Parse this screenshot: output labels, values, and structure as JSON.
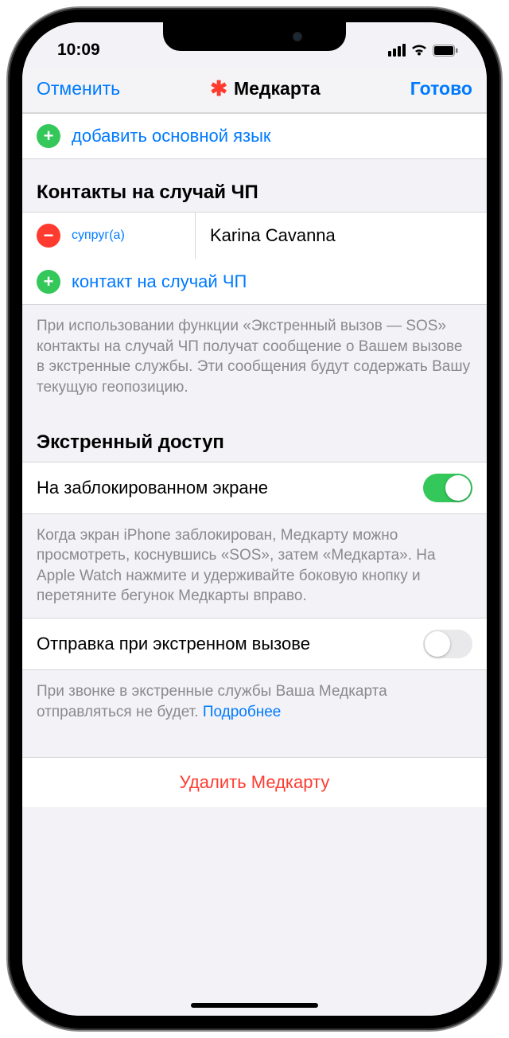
{
  "status": {
    "time": "10:09"
  },
  "nav": {
    "cancel": "Отменить",
    "title": "Медкарта",
    "done": "Готово"
  },
  "language": {
    "add_label": "добавить основной язык"
  },
  "emergency_contacts": {
    "header": "Контакты на случай ЧП",
    "contact": {
      "relation": "супруг(а)",
      "name": "Karina Cavanna"
    },
    "add_label": "контакт на случай ЧП",
    "footer": "При использовании функции «Экстренный вызов — SOS» контакты на случай ЧП получат сообщение о Вашем вызове в экстренные службы. Эти сообщения будут содержать Вашу текущую геопозицию."
  },
  "emergency_access": {
    "header": "Экстренный доступ",
    "lockscreen_label": "На заблокированном экране",
    "lockscreen_footer": "Когда экран iPhone заблокирован, Медкарту можно просмотреть, коснувшись «SOS», затем «Медкарта». На Apple Watch нажмите и удерживайте боковую кнопку и перетяните бегунок Медкарты вправо.",
    "share_label": "Отправка при экстренном вызове",
    "share_footer_text": "При звонке в экстренные службы Ваша Медкарта отправляться не будет. ",
    "share_footer_link": "Подробнее"
  },
  "delete_label": "Удалить Медкарту"
}
